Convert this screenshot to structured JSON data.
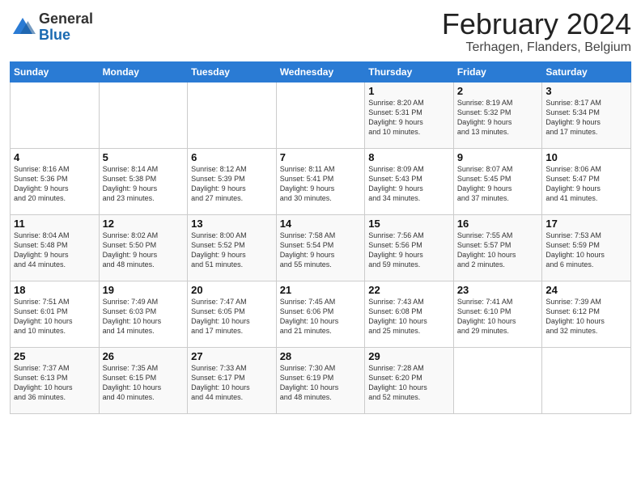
{
  "header": {
    "logo_general": "General",
    "logo_blue": "Blue",
    "title": "February 2024",
    "subtitle": "Terhagen, Flanders, Belgium"
  },
  "weekdays": [
    "Sunday",
    "Monday",
    "Tuesday",
    "Wednesday",
    "Thursday",
    "Friday",
    "Saturday"
  ],
  "weeks": [
    [
      {
        "day": "",
        "info": ""
      },
      {
        "day": "",
        "info": ""
      },
      {
        "day": "",
        "info": ""
      },
      {
        "day": "",
        "info": ""
      },
      {
        "day": "1",
        "info": "Sunrise: 8:20 AM\nSunset: 5:31 PM\nDaylight: 9 hours\nand 10 minutes."
      },
      {
        "day": "2",
        "info": "Sunrise: 8:19 AM\nSunset: 5:32 PM\nDaylight: 9 hours\nand 13 minutes."
      },
      {
        "day": "3",
        "info": "Sunrise: 8:17 AM\nSunset: 5:34 PM\nDaylight: 9 hours\nand 17 minutes."
      }
    ],
    [
      {
        "day": "4",
        "info": "Sunrise: 8:16 AM\nSunset: 5:36 PM\nDaylight: 9 hours\nand 20 minutes."
      },
      {
        "day": "5",
        "info": "Sunrise: 8:14 AM\nSunset: 5:38 PM\nDaylight: 9 hours\nand 23 minutes."
      },
      {
        "day": "6",
        "info": "Sunrise: 8:12 AM\nSunset: 5:39 PM\nDaylight: 9 hours\nand 27 minutes."
      },
      {
        "day": "7",
        "info": "Sunrise: 8:11 AM\nSunset: 5:41 PM\nDaylight: 9 hours\nand 30 minutes."
      },
      {
        "day": "8",
        "info": "Sunrise: 8:09 AM\nSunset: 5:43 PM\nDaylight: 9 hours\nand 34 minutes."
      },
      {
        "day": "9",
        "info": "Sunrise: 8:07 AM\nSunset: 5:45 PM\nDaylight: 9 hours\nand 37 minutes."
      },
      {
        "day": "10",
        "info": "Sunrise: 8:06 AM\nSunset: 5:47 PM\nDaylight: 9 hours\nand 41 minutes."
      }
    ],
    [
      {
        "day": "11",
        "info": "Sunrise: 8:04 AM\nSunset: 5:48 PM\nDaylight: 9 hours\nand 44 minutes."
      },
      {
        "day": "12",
        "info": "Sunrise: 8:02 AM\nSunset: 5:50 PM\nDaylight: 9 hours\nand 48 minutes."
      },
      {
        "day": "13",
        "info": "Sunrise: 8:00 AM\nSunset: 5:52 PM\nDaylight: 9 hours\nand 51 minutes."
      },
      {
        "day": "14",
        "info": "Sunrise: 7:58 AM\nSunset: 5:54 PM\nDaylight: 9 hours\nand 55 minutes."
      },
      {
        "day": "15",
        "info": "Sunrise: 7:56 AM\nSunset: 5:56 PM\nDaylight: 9 hours\nand 59 minutes."
      },
      {
        "day": "16",
        "info": "Sunrise: 7:55 AM\nSunset: 5:57 PM\nDaylight: 10 hours\nand 2 minutes."
      },
      {
        "day": "17",
        "info": "Sunrise: 7:53 AM\nSunset: 5:59 PM\nDaylight: 10 hours\nand 6 minutes."
      }
    ],
    [
      {
        "day": "18",
        "info": "Sunrise: 7:51 AM\nSunset: 6:01 PM\nDaylight: 10 hours\nand 10 minutes."
      },
      {
        "day": "19",
        "info": "Sunrise: 7:49 AM\nSunset: 6:03 PM\nDaylight: 10 hours\nand 14 minutes."
      },
      {
        "day": "20",
        "info": "Sunrise: 7:47 AM\nSunset: 6:05 PM\nDaylight: 10 hours\nand 17 minutes."
      },
      {
        "day": "21",
        "info": "Sunrise: 7:45 AM\nSunset: 6:06 PM\nDaylight: 10 hours\nand 21 minutes."
      },
      {
        "day": "22",
        "info": "Sunrise: 7:43 AM\nSunset: 6:08 PM\nDaylight: 10 hours\nand 25 minutes."
      },
      {
        "day": "23",
        "info": "Sunrise: 7:41 AM\nSunset: 6:10 PM\nDaylight: 10 hours\nand 29 minutes."
      },
      {
        "day": "24",
        "info": "Sunrise: 7:39 AM\nSunset: 6:12 PM\nDaylight: 10 hours\nand 32 minutes."
      }
    ],
    [
      {
        "day": "25",
        "info": "Sunrise: 7:37 AM\nSunset: 6:13 PM\nDaylight: 10 hours\nand 36 minutes."
      },
      {
        "day": "26",
        "info": "Sunrise: 7:35 AM\nSunset: 6:15 PM\nDaylight: 10 hours\nand 40 minutes."
      },
      {
        "day": "27",
        "info": "Sunrise: 7:33 AM\nSunset: 6:17 PM\nDaylight: 10 hours\nand 44 minutes."
      },
      {
        "day": "28",
        "info": "Sunrise: 7:30 AM\nSunset: 6:19 PM\nDaylight: 10 hours\nand 48 minutes."
      },
      {
        "day": "29",
        "info": "Sunrise: 7:28 AM\nSunset: 6:20 PM\nDaylight: 10 hours\nand 52 minutes."
      },
      {
        "day": "",
        "info": ""
      },
      {
        "day": "",
        "info": ""
      }
    ]
  ]
}
